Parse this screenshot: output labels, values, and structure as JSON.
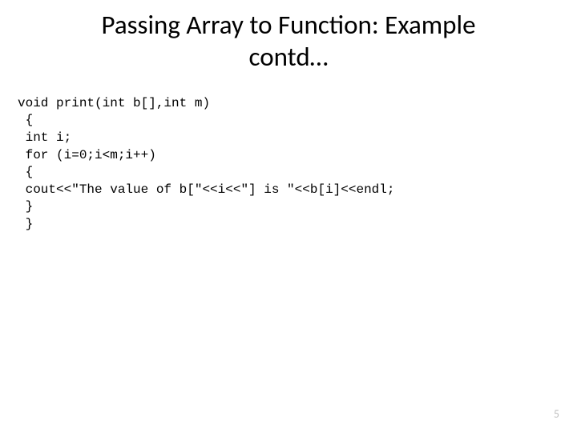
{
  "title_line1": "Passing Array to Function: Example",
  "title_line2": "contd…",
  "code": {
    "l1": "void print(int b[],int m)",
    "l2": " {",
    "l3": " int i;",
    "l4": " for (i=0;i<m;i++)",
    "l5": " {",
    "l6": " cout<<\"The value of b[\"<<i<<\"] is \"<<b[i]<<endl;",
    "l7": " }",
    "l8": " }"
  },
  "page_number": "5"
}
